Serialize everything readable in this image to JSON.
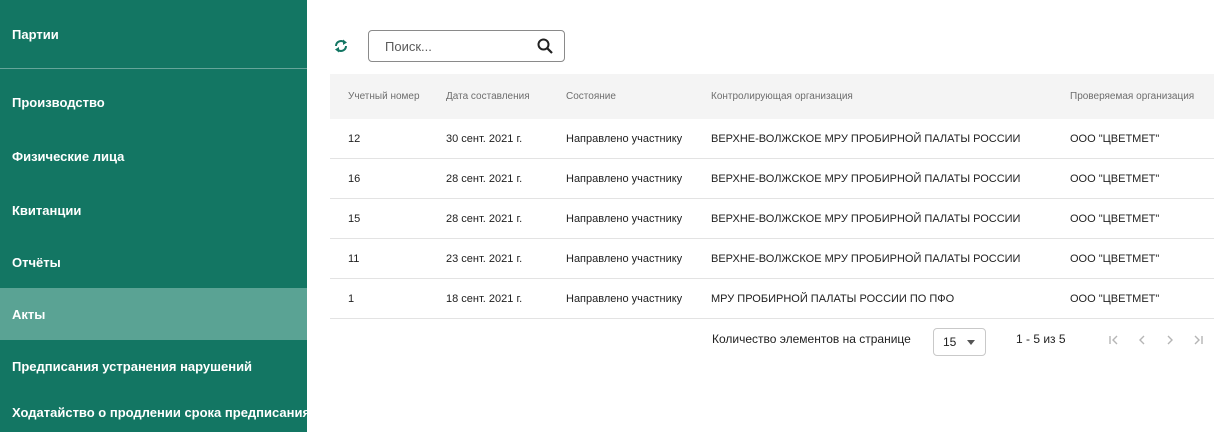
{
  "sidebar": {
    "items": [
      {
        "label": "Партии",
        "active": false
      },
      {
        "label": "Производство",
        "active": false
      },
      {
        "label": "Физические лица",
        "active": false
      },
      {
        "label": "Квитанции",
        "active": false
      },
      {
        "label": "Отчёты",
        "active": false
      },
      {
        "label": "Акты",
        "active": true
      },
      {
        "label": "Предписания устранения нарушений",
        "active": false
      },
      {
        "label": "Ходатайство о продлении срока предписания",
        "active": false
      }
    ]
  },
  "toolbar": {
    "refresh_icon": "refresh-icon",
    "search_placeholder": "Поиск...",
    "search_icon": "search-icon"
  },
  "table": {
    "columns": [
      "Учетный номер",
      "Дата составления",
      "Состояние",
      "Контролирующая организация",
      "Проверяемая организация"
    ],
    "rows": [
      [
        "12",
        "30 сент. 2021 г.",
        "Направлено участнику",
        "ВЕРХНЕ-ВОЛЖСКОЕ МРУ ПРОБИРНОЙ ПАЛАТЫ РОССИИ",
        "ООО \"ЦВЕТМЕТ\""
      ],
      [
        "16",
        "28 сент. 2021 г.",
        "Направлено участнику",
        "ВЕРХНЕ-ВОЛЖСКОЕ МРУ ПРОБИРНОЙ ПАЛАТЫ РОССИИ",
        "ООО \"ЦВЕТМЕТ\""
      ],
      [
        "15",
        "28 сент. 2021 г.",
        "Направлено участнику",
        "ВЕРХНЕ-ВОЛЖСКОЕ МРУ ПРОБИРНОЙ ПАЛАТЫ РОССИИ",
        "ООО \"ЦВЕТМЕТ\""
      ],
      [
        "11",
        "23 сент. 2021 г.",
        "Направлено участнику",
        "ВЕРХНЕ-ВОЛЖСКОЕ МРУ ПРОБИРНОЙ ПАЛАТЫ РОССИИ",
        "ООО \"ЦВЕТМЕТ\""
      ],
      [
        "1",
        "18 сент. 2021 г.",
        "Направлено участнику",
        "МРУ ПРОБИРНОЙ ПАЛАТЫ РОССИИ ПО ПФО",
        "ООО \"ЦВЕТМЕТ\""
      ]
    ]
  },
  "paginator": {
    "items_per_page_label": "Количество элементов на странице",
    "page_size": "15",
    "range_label": "1 - 5 из 5"
  },
  "colors": {
    "sidebar_bg": "#137663",
    "sidebar_active": "#5aa394",
    "accent": "#137663"
  }
}
